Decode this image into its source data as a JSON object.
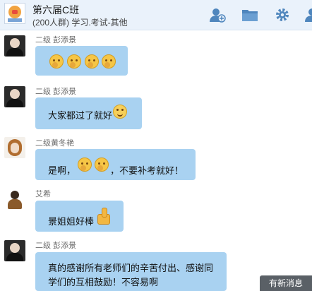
{
  "header": {
    "title": "第六届C班",
    "subtitle": "(200人群) 学习.考试-其他",
    "icons": [
      "add-member-icon",
      "folder-icon",
      "gear-icon",
      "user-icon"
    ]
  },
  "messages": [
    {
      "sender": "二级  彭添景",
      "text": "",
      "emojis": 4
    },
    {
      "sender": "二级  彭添景",
      "text": "大家都过了就好",
      "emoji": "smile"
    },
    {
      "sender": "二级黄冬艳",
      "text_before": "是啊，",
      "text_after": "，不要补考就好！",
      "emojis": 2
    },
    {
      "sender": "艾希",
      "text": "景姐姐好棒",
      "emoji": "thumbs-up"
    },
    {
      "sender": "二级  彭添景",
      "line1": "真的感谢所有老师们的辛苦付出、感谢同",
      "line2": "学们的互相鼓励！不容易啊"
    }
  ],
  "new_message_label": "有新消息",
  "colors": {
    "header_bg": "#eaf2fb",
    "bubble": "#a9d2f1",
    "icon": "#4f86bd"
  }
}
